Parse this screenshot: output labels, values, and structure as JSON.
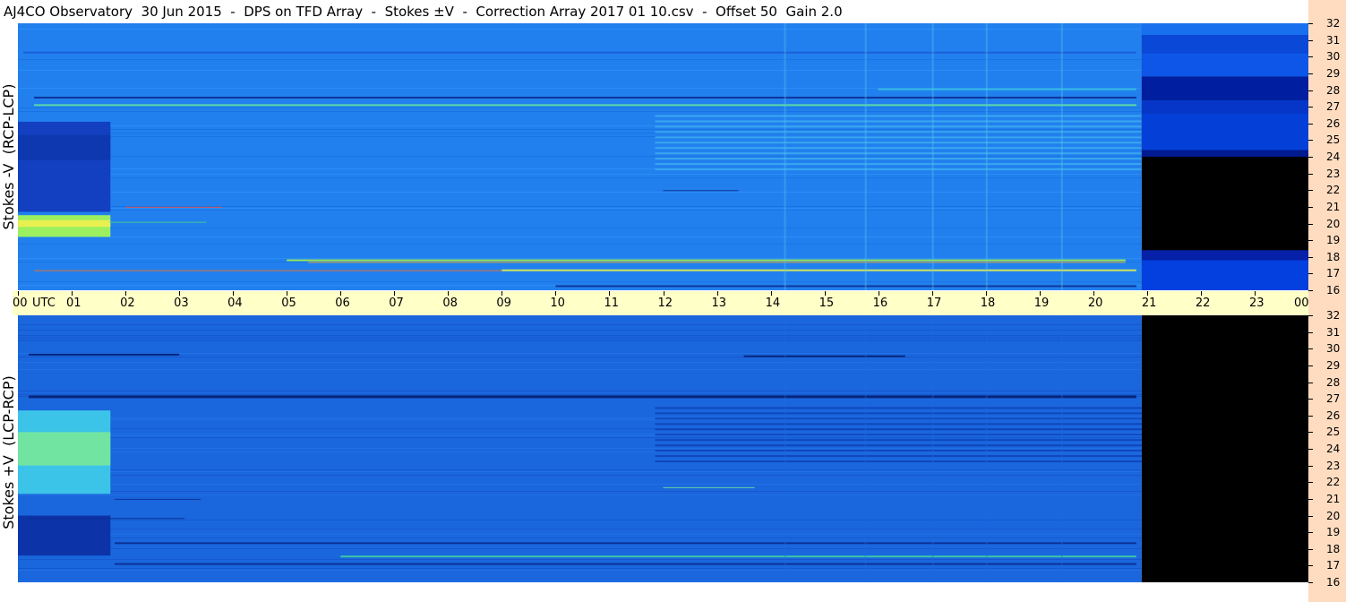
{
  "title": "AJ4CO Observatory  30 Jun 2015  -  DPS on TFD Array  -  Stokes ±V  -  Correction Array 2017 01 10.csv  -  Offset 50  Gain 2.0",
  "colors": {
    "background": "#ffffff",
    "time_axis_bg": "#ffffc8",
    "freq_strip_bg": "#ffdcc0",
    "spectrogram_base": "#1e78f0",
    "no_data": "#000000"
  },
  "chart_data": [
    {
      "type": "heatmap",
      "panel": "top",
      "ylabel": "Stokes -V  (RCP-LCP)",
      "x_ticks": [
        "00",
        "01",
        "02",
        "03",
        "04",
        "05",
        "06",
        "07",
        "08",
        "09",
        "10",
        "11",
        "12",
        "13",
        "14",
        "15",
        "16",
        "17",
        "18",
        "19",
        "20",
        "21",
        "22",
        "23",
        "00"
      ],
      "x_unit": "UTC",
      "x_range_hours": [
        0,
        24
      ],
      "y_ticks": [
        "16",
        "17",
        "18",
        "19",
        "20",
        "21",
        "22",
        "23",
        "24",
        "25",
        "26",
        "27",
        "28",
        "29",
        "30",
        "31",
        "32"
      ],
      "y_unit": "MHz",
      "y_range_mhz": [
        16,
        32
      ],
      "data_end_utc_hours": 20.9
    },
    {
      "type": "heatmap",
      "panel": "bottom",
      "ylabel": "Stokes +V  (LCP-RCP)",
      "x_ticks": [
        "00",
        "01",
        "02",
        "03",
        "04",
        "05",
        "06",
        "07",
        "08",
        "09",
        "10",
        "11",
        "12",
        "13",
        "14",
        "15",
        "16",
        "17",
        "18",
        "19",
        "20",
        "21",
        "22",
        "23",
        "00"
      ],
      "x_unit": "UTC",
      "x_range_hours": [
        0,
        24
      ],
      "y_ticks": [
        "16",
        "17",
        "18",
        "19",
        "20",
        "21",
        "22",
        "23",
        "24",
        "25",
        "26",
        "27",
        "28",
        "29",
        "30",
        "31",
        "32"
      ],
      "y_unit": "MHz",
      "y_range_mhz": [
        16,
        32
      ],
      "data_end_utc_hours": 20.9
    }
  ]
}
